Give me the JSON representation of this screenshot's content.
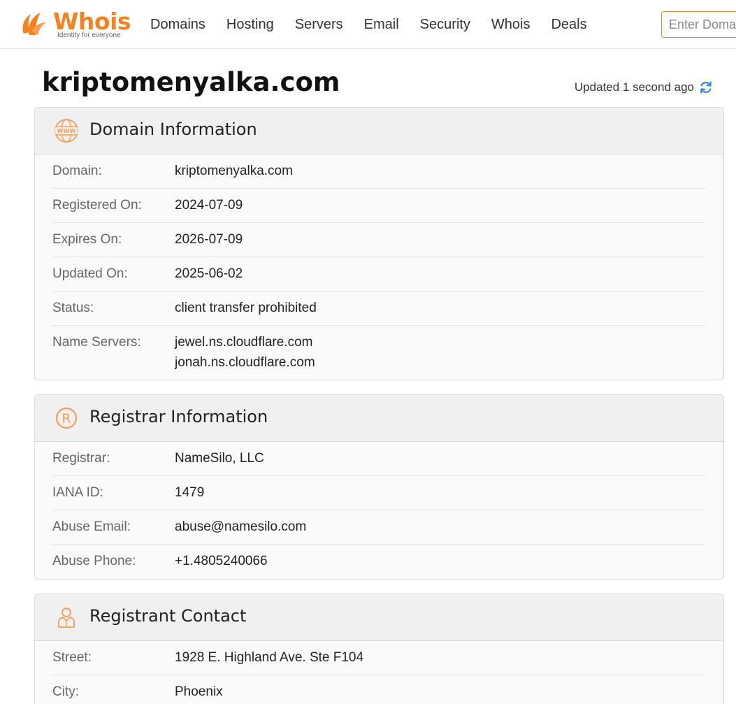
{
  "header": {
    "logo_text": "Whois",
    "logo_tagline": "Identity for everyone",
    "nav": [
      "Domains",
      "Hosting",
      "Servers",
      "Email",
      "Security",
      "Whois",
      "Deals"
    ],
    "search_placeholder": "Enter Domain"
  },
  "page": {
    "title": "kriptomenyalka.com",
    "updated": "Updated 1 second ago"
  },
  "domain_info": {
    "heading": "Domain Information",
    "icon": "www-icon",
    "rows": [
      {
        "label": "Domain:",
        "value": "kriptomenyalka.com"
      },
      {
        "label": "Registered On:",
        "value": "2024-07-09"
      },
      {
        "label": "Expires On:",
        "value": "2026-07-09"
      },
      {
        "label": "Updated On:",
        "value": "2025-06-02"
      },
      {
        "label": "Status:",
        "value": "client transfer prohibited"
      }
    ],
    "name_servers_label": "Name Servers:",
    "name_servers": [
      "jewel.ns.cloudflare.com",
      "jonah.ns.cloudflare.com"
    ]
  },
  "registrar_info": {
    "heading": "Registrar Information",
    "icon": "registered-icon",
    "rows": [
      {
        "label": "Registrar:",
        "value": "NameSilo, LLC"
      },
      {
        "label": "IANA ID:",
        "value": "1479"
      },
      {
        "label": "Abuse Email:",
        "value": "abuse@namesilo.com"
      },
      {
        "label": "Abuse Phone:",
        "value": "+1.4805240066"
      }
    ]
  },
  "registrant_contact": {
    "heading": "Registrant Contact",
    "icon": "person-icon",
    "rows": [
      {
        "label": "Street:",
        "value": "1928 E. Highland Ave. Ste F104"
      },
      {
        "label": "City:",
        "value": "Phoenix"
      }
    ]
  },
  "colors": {
    "accent": "#f58220",
    "icon": "#f0a05a",
    "refresh": "#3a86d4"
  }
}
